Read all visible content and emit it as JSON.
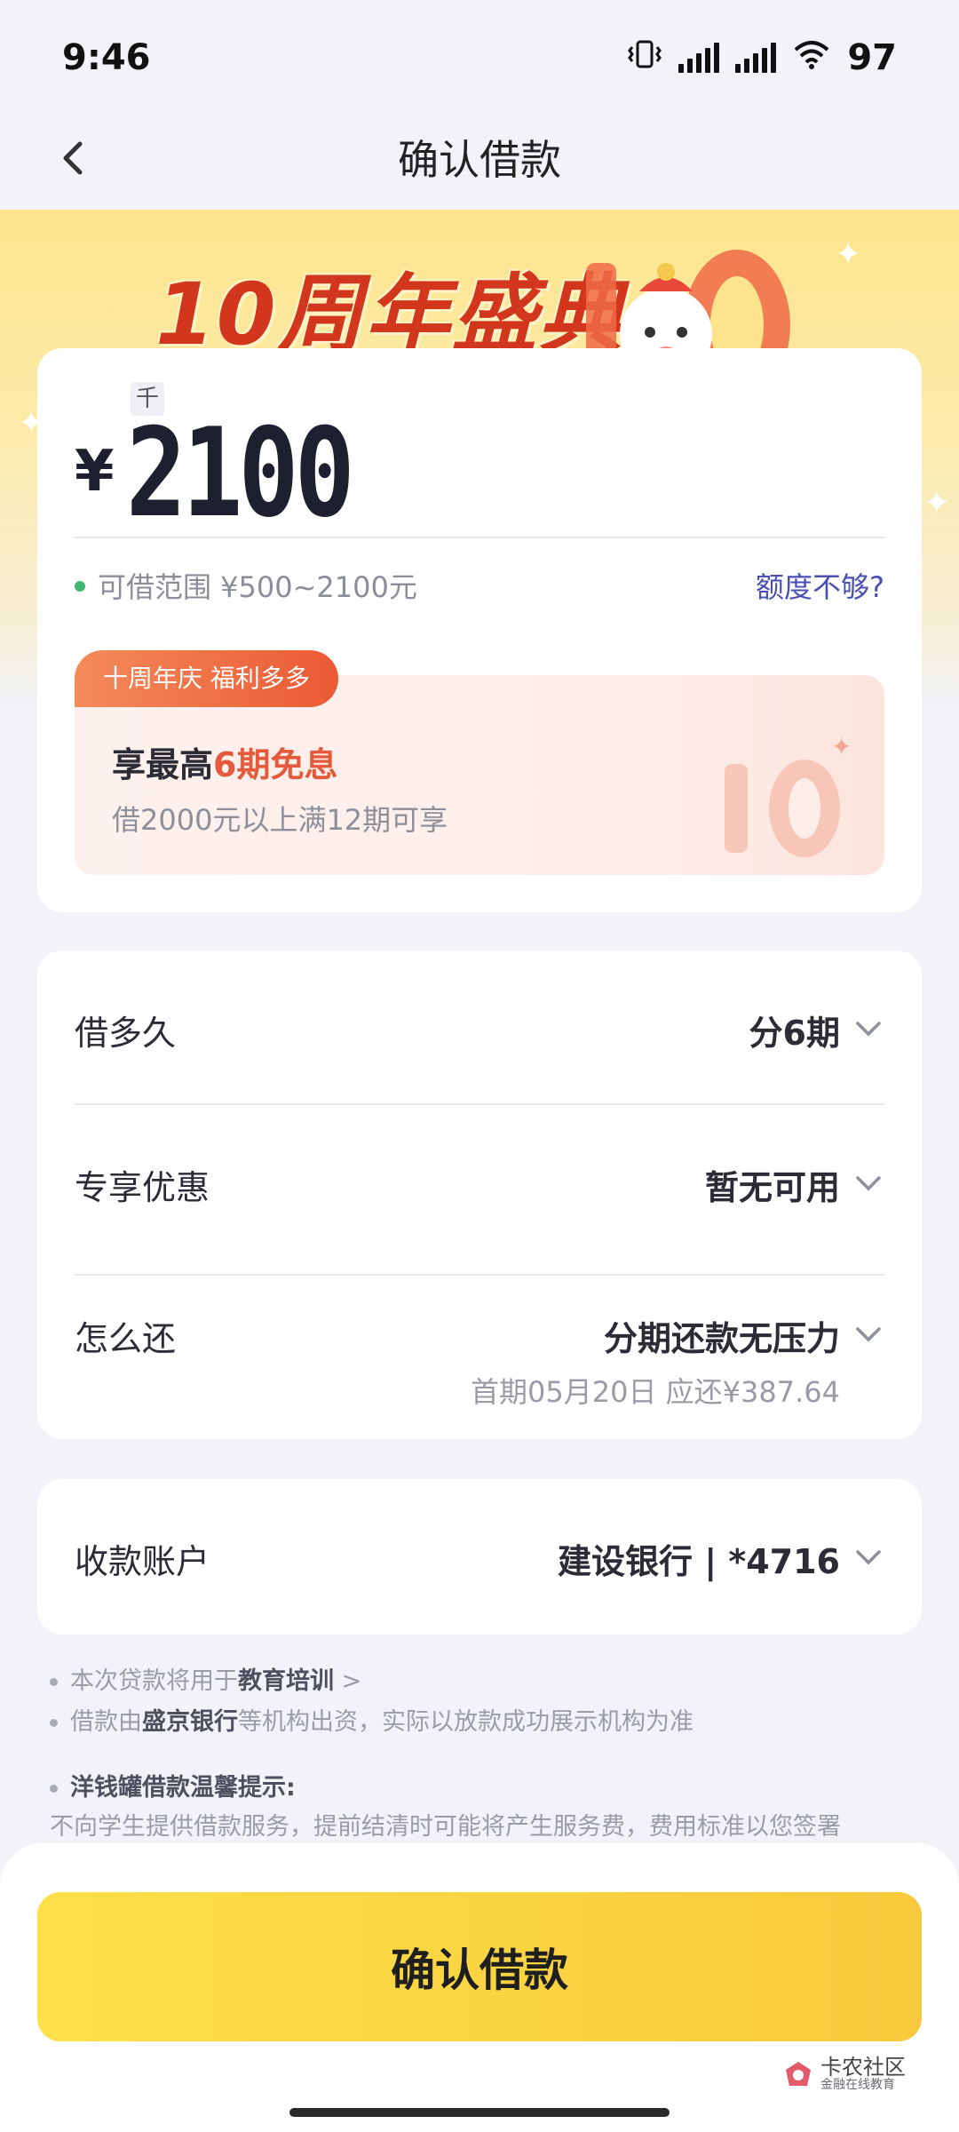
{
  "status_bar": {
    "time": "9:46",
    "battery": "97"
  },
  "nav": {
    "title": "确认借款"
  },
  "banner": {
    "title": "10周年盛典"
  },
  "amount_card": {
    "unit_label": "千",
    "currency": "¥",
    "amount": "2100",
    "range_text": "可借范围 ¥500~2100元",
    "quota_link": "额度不够?",
    "promo_tag": "十周年庆 福利多多",
    "promo_headline_prefix": "享最高",
    "promo_headline_highlight": "6期免息",
    "promo_sub": "借2000元以上满12期可享"
  },
  "details": {
    "rows": [
      {
        "label": "借多久",
        "value": "分6期"
      },
      {
        "label": "专享优惠",
        "value": "暂无可用"
      },
      {
        "label": "怎么还",
        "value": "分期还款无压力",
        "sub": "首期05月20日 应还¥387.64"
      }
    ]
  },
  "account": {
    "label": "收款账户",
    "value": "建设银行 | *4716"
  },
  "notes": {
    "n1_prefix": "本次贷款将用于",
    "n1_bold": "教育培训",
    "n1_suffix": ">",
    "n2_prefix": "借款由",
    "n2_bold": "盛京银行",
    "n2_suffix": "等机构出资，实际以放款成功展示机构为准",
    "n3_title": "洋钱罐借款温馨提示:",
    "n3_body": "不向学生提供借款服务，提前结清时可能将产生服务费，费用标准以您签署"
  },
  "bottom": {
    "confirm_label": "确认借款",
    "watermark_line1": "卡农社区",
    "watermark_line2": "金融在线教育"
  },
  "colors": {
    "accent_yellow": "#f8c93c",
    "promo_red": "#e45a3c",
    "link_blue": "#4a4fb4",
    "status_green": "#3cb872"
  }
}
